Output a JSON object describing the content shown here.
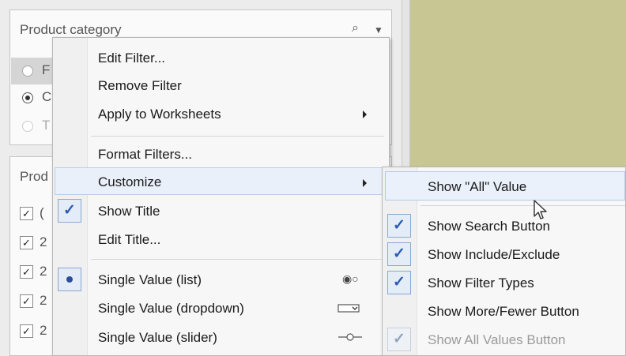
{
  "filter_card_1": {
    "title": "Product category",
    "search_icon": "search-icon",
    "dropdown_icon": "chevron-down-icon",
    "partial_labels": [
      "F",
      "C",
      "T"
    ]
  },
  "filter_card_2": {
    "title": "Prod",
    "partial_labels": [
      "(",
      "2",
      "2",
      "2",
      "2"
    ]
  },
  "menu": {
    "items": [
      {
        "label": "Edit Filter..."
      },
      {
        "label": "Remove Filter"
      },
      {
        "label": "Apply to Worksheets",
        "submenu": true
      },
      {
        "label": "Format Filters..."
      },
      {
        "label": "Customize",
        "submenu": true,
        "highlighted": true
      },
      {
        "label": "Show Title",
        "checked": true
      },
      {
        "label": "Edit Title..."
      },
      {
        "label": "Single Value (list)",
        "selected": true,
        "icon": "radio-list-icon"
      },
      {
        "label": "Single Value (dropdown)",
        "icon": "dropdown-icon"
      },
      {
        "label": "Single Value (slider)",
        "icon": "slider-icon"
      }
    ]
  },
  "submenu": {
    "items": [
      {
        "label": "Show \"All\" Value",
        "highlighted": true
      },
      {
        "label": "Show Search Button",
        "checked": true
      },
      {
        "label": "Show Include/Exclude",
        "checked": true
      },
      {
        "label": "Show Filter Types",
        "checked": true
      },
      {
        "label": "Show More/Fewer Button",
        "checked": false
      },
      {
        "label": "Show All Values Button",
        "checked": true,
        "disabled": true
      }
    ]
  },
  "colors": {
    "worksheet_bg": "#c8c794",
    "check_accent": "#2a5cb5",
    "highlight": "#e9f0fa"
  }
}
